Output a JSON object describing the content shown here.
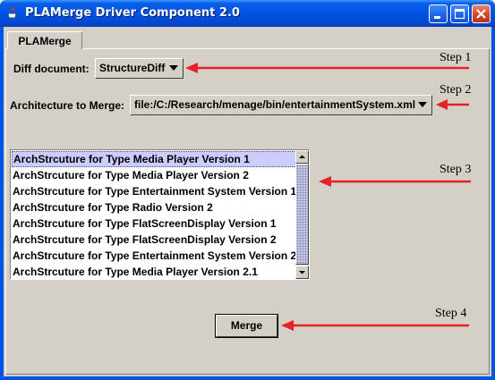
{
  "window": {
    "title": "PLAMerge Driver Component 2.0",
    "controls": {
      "minimize": "minimize-icon",
      "maximize": "maximize-icon",
      "close": "close-icon"
    }
  },
  "tab": {
    "label": "PLAMerge"
  },
  "diff_document": {
    "label": "Diff document:",
    "selected_value": "StructureDiff"
  },
  "architecture": {
    "label": "Architecture to Merge:",
    "selected_value": "file:/C:/Research/menage/bin/entertainmentSystem.xml"
  },
  "architecture_list": {
    "items": [
      "ArchStrcuture for Type Media Player Version 1",
      "ArchStrcuture for Type Media Player Version 2",
      "ArchStrcuture for Type Entertainment System Version 1",
      "ArchStrcuture for Type Radio Version 2",
      "ArchStrcuture for Type FlatScreenDisplay Version 1",
      "ArchStrcuture for Type FlatScreenDisplay Version 2",
      "ArchStrcuture for Type Entertainment System Version 2",
      "ArchStrcuture for Type Media Player Version 2.1"
    ],
    "selected_index": 0
  },
  "merge_button": {
    "label": "Merge"
  },
  "steps": [
    "Step 1",
    "Step 2",
    "Step 3",
    "Step 4"
  ],
  "colors": {
    "arrow": "#e8202a",
    "title_bar": "#0054e3",
    "selection": "#ccccff",
    "panel": "#d4d0c8"
  }
}
